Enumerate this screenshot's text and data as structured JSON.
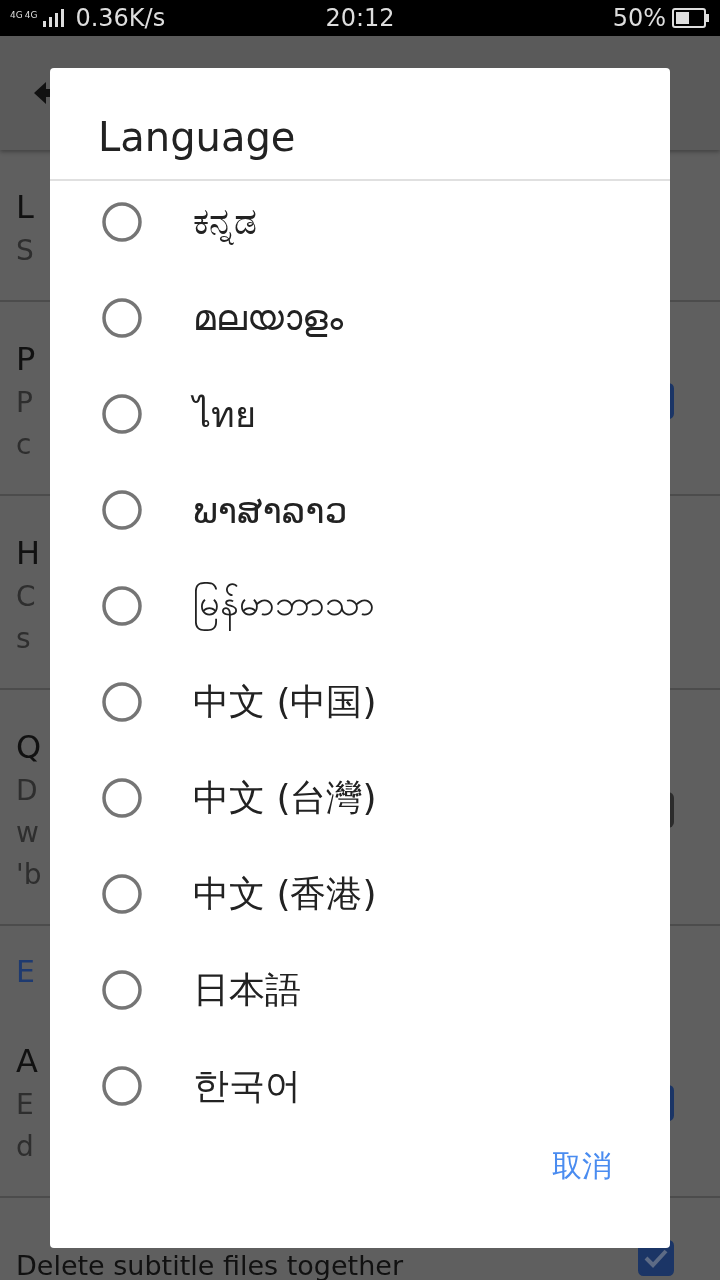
{
  "status_bar": {
    "network_labels": [
      "4G",
      "4G"
    ],
    "speed": "0.36K/s",
    "time": "20:12",
    "battery": "50%"
  },
  "background": {
    "rows": [
      {
        "kind": "setting",
        "title": "L",
        "summary": [
          "S"
        ]
      },
      {
        "kind": "setting",
        "title": "P",
        "summary": [
          "P",
          "c"
        ],
        "control": {
          "kind": "checkbox",
          "checked": true
        }
      },
      {
        "kind": "setting",
        "title": "H",
        "summary": [
          "C",
          "s"
        ]
      },
      {
        "kind": "setting",
        "title": "Q",
        "summary": [
          "D",
          "w",
          "'b"
        ],
        "control": {
          "kind": "switch",
          "checked": false
        }
      },
      {
        "kind": "header",
        "title": "E"
      },
      {
        "kind": "setting",
        "title": "A",
        "summary": [
          "E",
          "d"
        ],
        "control": {
          "kind": "checkbox",
          "checked": true
        }
      },
      {
        "kind": "setting",
        "title": "Delete subtitle files together",
        "control": {
          "kind": "checkbox",
          "checked": true
        }
      }
    ]
  },
  "dialog": {
    "title": "Language",
    "options": [
      {
        "label": "ಕನ್ನಡ",
        "selected": false
      },
      {
        "label": "മലയാളം",
        "selected": false
      },
      {
        "label": "ไทย",
        "selected": false
      },
      {
        "label": "ພາສາລາວ",
        "selected": false
      },
      {
        "label": "မြန်မာဘာသာ",
        "selected": false
      },
      {
        "label": "中文 (中国)",
        "selected": false
      },
      {
        "label": "中文 (台灣)",
        "selected": false
      },
      {
        "label": "中文 (香港)",
        "selected": false
      },
      {
        "label": "日本語",
        "selected": false
      },
      {
        "label": "한국어",
        "selected": false
      }
    ],
    "cancel": "取消"
  }
}
